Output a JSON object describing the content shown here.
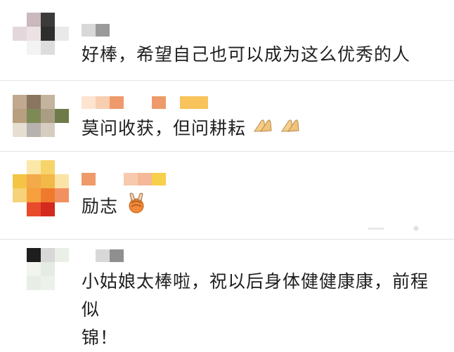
{
  "comments": [
    {
      "text": "好棒，希望自己也可以成为这么优秀的人"
    },
    {
      "text": "莫问收获，但问耕耘",
      "emoji": [
        "palms-together-emoji",
        "palms-together-emoji"
      ]
    },
    {
      "text": "励志",
      "emoji": [
        "victory-hand-emoji"
      ]
    },
    {
      "text_line1": "小姑娘太棒啦，祝以后身体健健康康，前程似",
      "text_line2": "锦！"
    }
  ],
  "colors": {
    "divider": "#e3e3e3",
    "text": "#1f1f1f"
  }
}
